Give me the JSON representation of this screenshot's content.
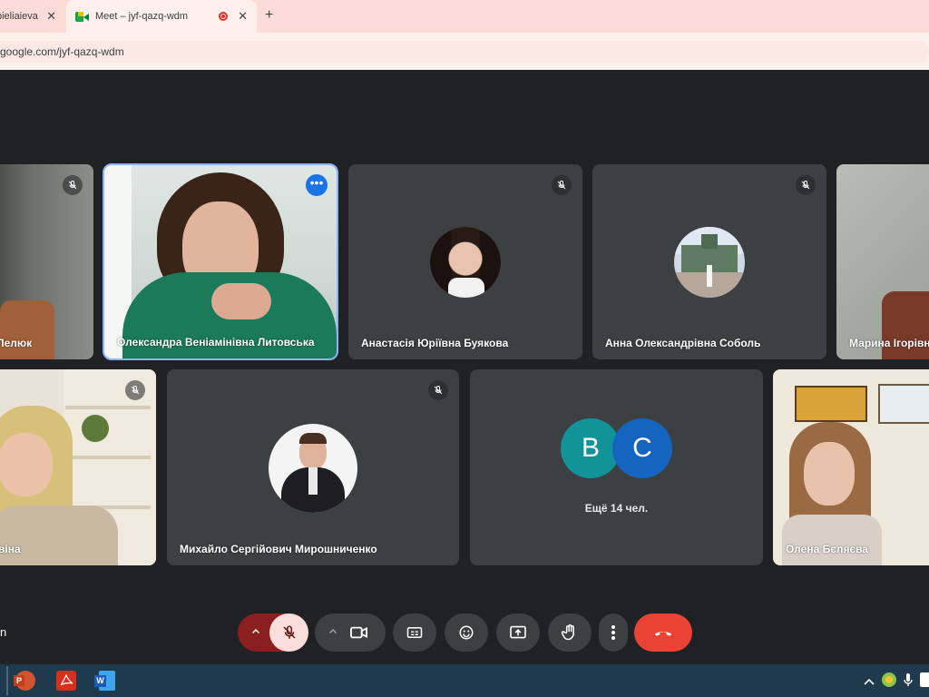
{
  "browser": {
    "tabs": [
      {
        "label": "pieliaieva",
        "close": "✕"
      },
      {
        "label": "Meet – jyf-qazq-wdm",
        "close": "✕"
      }
    ],
    "new_tab": "+",
    "url": "google.com/jyf-qazq-wdm"
  },
  "meet": {
    "tiles": [
      {
        "name": "Пелюк",
        "kind": "video",
        "muted": true
      },
      {
        "name": "Олександра Веніамінівна Литовська",
        "kind": "video",
        "muted": false,
        "selected": true,
        "more": "•••"
      },
      {
        "name": "Анастасія Юріївна Буякова",
        "kind": "avatar",
        "muted": true
      },
      {
        "name": "Анна Олександрівна Соболь",
        "kind": "avatar",
        "muted": true
      },
      {
        "name": "Марина Ігорівн",
        "kind": "video",
        "muted": false
      },
      {
        "name": "віна",
        "kind": "video",
        "muted": true
      },
      {
        "name": "Михайло Сергійович Мирошниченко",
        "kind": "avatar",
        "muted": true
      },
      {
        "name": "",
        "kind": "more",
        "letters": [
          "В",
          "С"
        ],
        "more_text": "Ещё 14 чел."
      },
      {
        "name": "Олена Бєляєва",
        "kind": "video",
        "muted": false
      }
    ],
    "letter_colors": [
      "#12939a",
      "#1565c0"
    ],
    "left_label": "n"
  },
  "controls": {
    "end_call_color": "#ea4335",
    "icons": [
      "chevron-up-icon",
      "mic-off-icon",
      "chevron-up-icon",
      "camera-icon",
      "captions-icon",
      "emoji-icon",
      "present-icon",
      "raise-hand-icon",
      "more-vert-icon",
      "end-call-icon"
    ]
  },
  "taskbar": {
    "apps": [
      "powerpoint-icon",
      "acrobat-icon",
      "word-icon"
    ]
  }
}
